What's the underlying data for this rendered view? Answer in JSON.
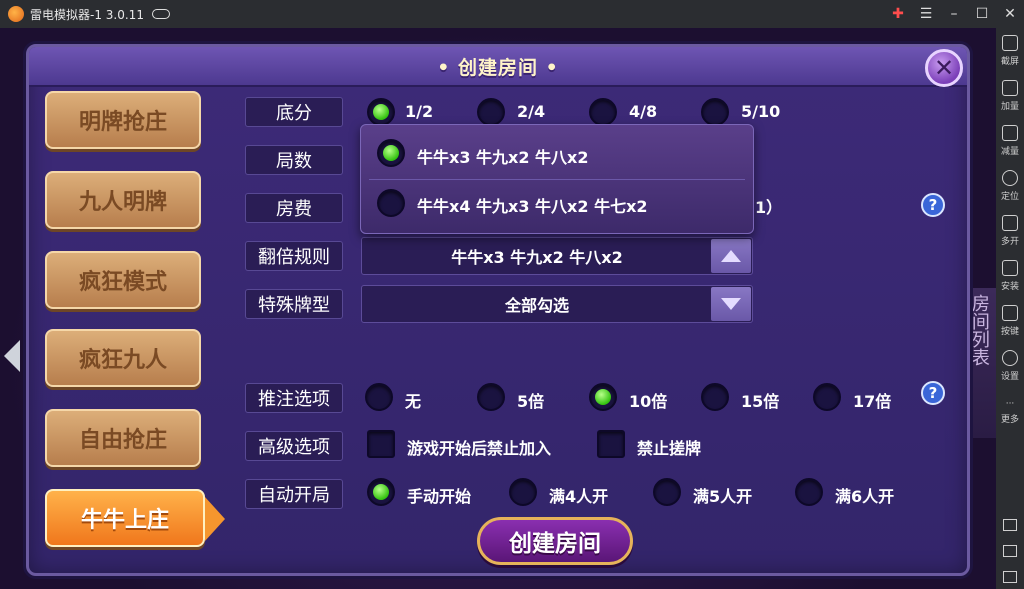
{
  "emulator": {
    "title": "雷电模拟器-1 3.0.11",
    "sidebar": [
      {
        "label": "截屏",
        "icon": "scissors-icon"
      },
      {
        "label": "加量",
        "icon": "volume-up-icon"
      },
      {
        "label": "减量",
        "icon": "volume-down-icon"
      },
      {
        "label": "定位",
        "icon": "location-icon"
      },
      {
        "label": "多开",
        "icon": "multi-instance-icon"
      },
      {
        "label": "安装",
        "icon": "install-apk-icon"
      },
      {
        "label": "按键",
        "icon": "keyboard-icon"
      },
      {
        "label": "设置",
        "icon": "settings-icon"
      },
      {
        "label": "更多",
        "icon": "more-icon"
      }
    ]
  },
  "background": {
    "room_list_label": "房间列表"
  },
  "dialog": {
    "title": "• 创建房间 •",
    "create_button": "创建房间",
    "modes": [
      "明牌抢庄",
      "九人明牌",
      "疯狂模式",
      "疯狂九人",
      "自由抢庄",
      "牛牛上庄"
    ],
    "active_mode": "牛牛上庄",
    "labels": {
      "base_score": "底分",
      "rounds": "局数",
      "room_fee": "房费",
      "double_rule": "翻倍规则",
      "special_cards": "特殊牌型",
      "bet_option": "推注选项",
      "advanced": "高级选项",
      "auto_start": "自动开局"
    },
    "base_score_options": [
      "1/2",
      "2/4",
      "4/8",
      "5/10"
    ],
    "base_score_selected": "1/2",
    "room_fee_fragment": "1）",
    "double_rule_popup": [
      "牛牛x3  牛九x2  牛八x2",
      "牛牛x4  牛九x3  牛八x2  牛七x2"
    ],
    "double_rule_selected": "牛牛x3  牛九x2  牛八x2",
    "double_rule_value": "牛牛x3  牛九x2  牛八x2",
    "special_cards_value": "全部勾选",
    "bet_options": [
      "无",
      "5倍",
      "10倍",
      "15倍",
      "17倍"
    ],
    "bet_selected": "10倍",
    "advanced_options": [
      "游戏开始后禁止加入",
      "禁止搓牌"
    ],
    "auto_start_options": [
      "手动开始",
      "满4人开",
      "满5人开",
      "满6人开"
    ],
    "auto_start_selected": "手动开始",
    "help_glyph": "?"
  },
  "colors": {
    "selected_radio": "#33c20f",
    "active_mode": "#f0771c",
    "dialog_bg": "#3d2a78"
  }
}
